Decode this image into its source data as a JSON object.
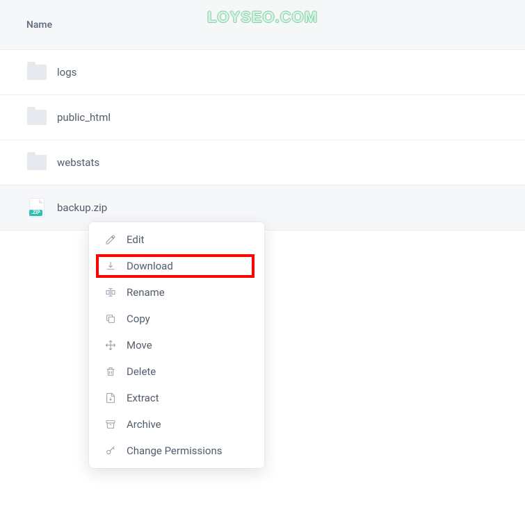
{
  "watermark": "LOYSEO.COM",
  "header": {
    "name_column": "Name"
  },
  "files": [
    {
      "name": "logs",
      "type": "folder"
    },
    {
      "name": "public_html",
      "type": "folder"
    },
    {
      "name": "webstats",
      "type": "folder"
    },
    {
      "name": "backup.zip",
      "type": "zip",
      "badge": ".ZIP",
      "selected": true
    }
  ],
  "context_menu": {
    "items": [
      {
        "label": "Edit",
        "icon": "edit"
      },
      {
        "label": "Download",
        "icon": "download",
        "highlighted": true
      },
      {
        "label": "Rename",
        "icon": "rename"
      },
      {
        "label": "Copy",
        "icon": "copy"
      },
      {
        "label": "Move",
        "icon": "move"
      },
      {
        "label": "Delete",
        "icon": "delete"
      },
      {
        "label": "Extract",
        "icon": "extract"
      },
      {
        "label": "Archive",
        "icon": "archive"
      },
      {
        "label": "Change Permissions",
        "icon": "key"
      }
    ]
  }
}
